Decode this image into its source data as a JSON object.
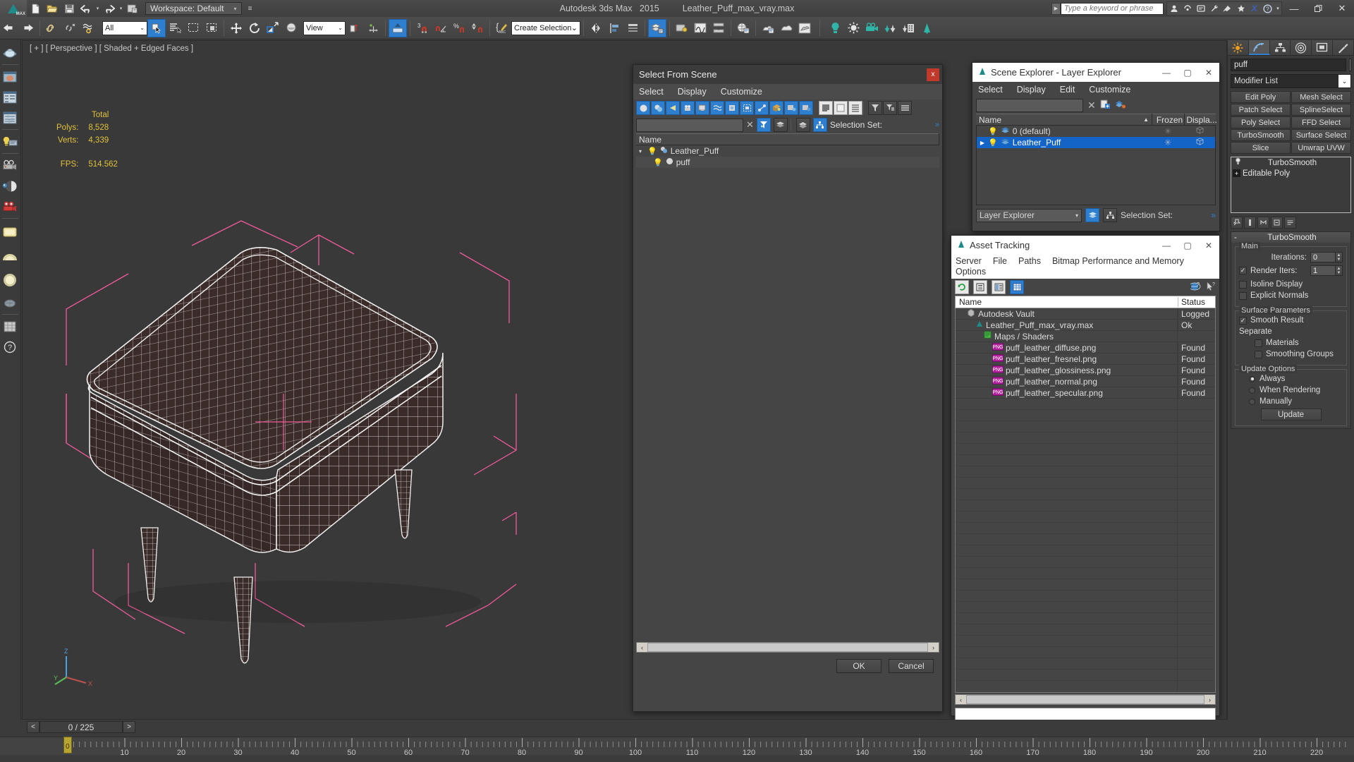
{
  "app": {
    "title_product": "Autodesk 3ds Max",
    "title_version": "2015",
    "title_file": "Leather_Puff_max_vray.max",
    "workspace_label": "Workspace: Default",
    "search_placeholder": "Type a keyword or phrase",
    "accent_blue": "#2f7fd0",
    "bg_dark": "#3b3b3b",
    "stat_yellow": "#e0c13a"
  },
  "titlebar": {
    "quick_icons": [
      "new-file-icon",
      "open-file-icon",
      "save-file-icon",
      "undo-icon",
      "undo-dropdown-icon",
      "redo-icon",
      "redo-dropdown-icon",
      "project-folder-icon"
    ],
    "workspace_arrow": "▾",
    "right_icons": [
      "sign-in-icon",
      "autodesk-360-icon",
      "exchange-app-icon",
      "wrench-icon",
      "communication-center-icon",
      "favorites-star-icon",
      "xref-icon",
      "help-icon"
    ],
    "window_buttons": [
      "minimize",
      "restore",
      "close"
    ]
  },
  "main_toolbar": {
    "groups": [
      {
        "name": "undo-redo",
        "items": [
          "undo-arrow-icon",
          "redo-arrow-icon"
        ]
      },
      {
        "name": "link",
        "items": [
          "select-and-link-icon",
          "unlink-selection-icon",
          "bind-to-space-warp-icon"
        ]
      },
      {
        "name": "filter",
        "selected_filter": "All"
      },
      {
        "name": "selection",
        "items": [
          "select-object-icon",
          "select-by-name-icon",
          "rectangular-region-icon",
          "window-crossing-icon"
        ]
      },
      {
        "name": "transform",
        "items": [
          "select-and-move-icon",
          "select-and-rotate-icon",
          "select-and-scale-icon",
          "placement-icon"
        ]
      },
      {
        "name": "coordinate",
        "selected_ref": "View"
      },
      {
        "name": "pivot",
        "items": [
          "use-pivot-point-center-icon"
        ]
      },
      {
        "name": "snap",
        "items": [
          "snaps-toggle-3-icon",
          "angle-snap-icon",
          "percent-snap-icon",
          "spinner-snap-icon"
        ]
      },
      {
        "name": "named-selection",
        "value": "Create Selection Se"
      },
      {
        "name": "mirror-align",
        "items": [
          "mirror-icon",
          "align-icon",
          "layer-manager-icon"
        ]
      },
      {
        "name": "explorers",
        "items": [
          "scene-explorer-icon",
          "manage-layers-icon",
          "curve-editor-icon",
          "schematic-view-icon"
        ]
      },
      {
        "name": "render-tools",
        "items": [
          "material-editor-icon",
          "render-setup-icon",
          "rendered-frame-window-icon",
          "render-production-icon"
        ]
      },
      {
        "name": "create-objects",
        "items": [
          "omni-light-icon",
          "sun-light-icon",
          "camera-icon",
          "foliage-icon",
          "building-icon",
          "tree-icon"
        ]
      }
    ]
  },
  "left_toolbar": {
    "items": [
      "teapot-preview-icon",
      "render-preview-icon",
      "properties-panel-icon",
      "settings-panel-icon",
      "light-setup-icon",
      "camera-setup-icon",
      "material-sphere-icon",
      "render-camera-icon",
      "plane-light-icon",
      "dome-light-icon",
      "sphere-light-icon",
      "teapot-mesh-icon",
      "grid-icon",
      "help-circle-icon"
    ]
  },
  "viewport": {
    "label": "[ + ] [ Perspective ] [ Shaded + Edged Faces ]",
    "stats_header": "Total",
    "stats": [
      {
        "label": "Polys:",
        "value": "8,528"
      },
      {
        "label": "Verts:",
        "value": "4,339"
      }
    ],
    "fps_label": "FPS:",
    "fps_value": "514.562",
    "object_name": "Leather Puff wireframe model",
    "gizmo_color": "#ff4fa0"
  },
  "select_from_scene": {
    "title": "Select From Scene",
    "close_label": "x",
    "menus": [
      "Select",
      "Display",
      "Customize"
    ],
    "toolbar_icons": [
      "display-geometry-icon",
      "display-shapes-icon",
      "display-lights-icon",
      "display-cameras-icon",
      "display-helpers-icon",
      "display-space-warps-icon",
      "display-groups-icon",
      "display-xrefs-icon",
      "display-bones-icon",
      "display-containers-icon",
      "display-particles-icon",
      "display-freeze-icon",
      "expand-all-icon",
      "collapse-all-icon",
      "list-view-icon",
      "filter-icon",
      "filter-selected-icon",
      "sort-icon"
    ],
    "search_value": "",
    "clear_label": "✕",
    "filter_active_icon": "selection-filter-icon",
    "layer_icon": "layers-icon",
    "layers_toggle_icon": "layers-stack-icon",
    "hierarchy_icon": "hierarchy-icon",
    "selection_set_label": "Selection Set:",
    "column_name": "Name",
    "rows": [
      {
        "indent": 0,
        "expander": "▾",
        "icon": "bulb-icon",
        "type_icon": "object-icon",
        "name": "Leather_Puff"
      },
      {
        "indent": 1,
        "expander": "",
        "icon": "bulb-icon",
        "type_icon": "sphere-icon",
        "name": "puff"
      }
    ],
    "ok_label": "OK",
    "cancel_label": "Cancel"
  },
  "scene_explorer": {
    "title": "Scene Explorer - Layer Explorer",
    "app_icon": "max-logo-icon",
    "menus": [
      "Select",
      "Display",
      "Edit",
      "Customize"
    ],
    "search_value": "",
    "clear_icon": "clear-x-icon",
    "new_layer_icon": "new-layer-icon",
    "layer_tools_icon": "layer-tools-icon",
    "columns": [
      "Name",
      "Frozen",
      "Displa..."
    ],
    "sort_arrow": "▲",
    "rows": [
      {
        "name": "0 (default)",
        "selected": false,
        "expander": "",
        "frozen_icon": "snowflake-icon",
        "display_icon": "display-box-icon"
      },
      {
        "name": "Leather_Puff",
        "selected": true,
        "expander": "▶",
        "frozen_icon": "snowflake-icon",
        "display_icon": "display-box-icon"
      }
    ],
    "footer_select_value": "Layer Explorer",
    "footer_dropdown": "▾",
    "footer_icons": [
      "layers-icon",
      "hierarchy-icon"
    ],
    "footer_selection_set": "Selection Set:",
    "window_buttons": [
      "minimize",
      "maximize",
      "close"
    ]
  },
  "asset_tracking": {
    "title": "Asset Tracking",
    "app_icon": "max-logo-icon",
    "menus": [
      "Server",
      "File",
      "Paths",
      "Bitmap Performance and Memory",
      "Options"
    ],
    "toolbar_icons": [
      "refresh-icon",
      "list-view-icon",
      "detail-view-icon",
      "grid-view-icon"
    ],
    "toolbar_right_icons": [
      "globe-help-icon",
      "help-arrow-icon"
    ],
    "columns": [
      "Name",
      "Status"
    ],
    "rows": [
      {
        "indent": 0,
        "icon": "vault-icon",
        "name": "Autodesk Vault",
        "status": "Logged"
      },
      {
        "indent": 1,
        "icon": "max-file-icon",
        "name": "Leather_Puff_max_vray.max",
        "status": "Ok"
      },
      {
        "indent": 2,
        "icon": "maps-shaders-icon",
        "name": "Maps / Shaders",
        "status": ""
      },
      {
        "indent": 3,
        "icon": "png-icon",
        "name": "puff_leather_diffuse.png",
        "status": "Found"
      },
      {
        "indent": 3,
        "icon": "png-icon",
        "name": "puff_leather_fresnel.png",
        "status": "Found"
      },
      {
        "indent": 3,
        "icon": "png-icon",
        "name": "puff_leather_glossiness.png",
        "status": "Found"
      },
      {
        "indent": 3,
        "icon": "png-icon",
        "name": "puff_leather_normal.png",
        "status": "Found"
      },
      {
        "indent": 3,
        "icon": "png-icon",
        "name": "puff_leather_specular.png",
        "status": "Found"
      }
    ],
    "status_bar_value": "",
    "window_buttons": [
      "minimize",
      "maximize",
      "close"
    ]
  },
  "command_panel": {
    "tabs": [
      "create-tab-icon",
      "modify-tab-icon",
      "hierarchy-tab-icon",
      "motion-tab-icon",
      "display-tab-icon",
      "utilities-tab-icon"
    ],
    "selected_tab_index": 1,
    "object_name": "puff",
    "modifier_list_label": "Modifier List",
    "modifier_buttons": [
      "Edit Poly",
      "Mesh Select",
      "Patch Select",
      "SplineSelect",
      "Poly Select",
      "FFD Select",
      "TurboSmooth",
      "Surface Select",
      "Slice",
      "Unwrap UVW"
    ],
    "stack": [
      {
        "name": "TurboSmooth",
        "icon": "lightbulb-stack-icon",
        "expandable": false
      },
      {
        "name": "Editable Poly",
        "icon": "plus-expand-icon",
        "expandable": true
      }
    ],
    "stack_tool_icons": [
      "pin-stack-icon",
      "show-end-result-icon",
      "make-unique-icon",
      "remove-modifier-icon",
      "configure-sets-icon"
    ],
    "turbosmooth": {
      "rollout_title": "TurboSmooth",
      "collapse_glyph": "-",
      "main_group": "Main",
      "iterations_label": "Iterations:",
      "iterations_value": "0",
      "render_iters_label": "Render Iters:",
      "render_iters_value": "1",
      "render_iters_checked": true,
      "isoline_label": "Isoline Display",
      "isoline_checked": false,
      "explicit_normals_label": "Explicit Normals",
      "explicit_normals_checked": false,
      "surface_group": "Surface Parameters",
      "smooth_result_label": "Smooth Result",
      "smooth_result_checked": true,
      "separate_label": "Separate",
      "materials_label": "Materials",
      "materials_checked": false,
      "smoothing_groups_label": "Smoothing Groups",
      "smoothing_groups_checked": false,
      "update_group": "Update Options",
      "update_options": [
        "Always",
        "When Rendering",
        "Manually"
      ],
      "update_selected": 0,
      "update_button": "Update"
    }
  },
  "timeline": {
    "frame_display": "0 / 225",
    "prev_label": "<",
    "next_label": ">",
    "key_filter_icon": "key-filter-icon",
    "current_frame": 0,
    "range_start": 0,
    "range_end": 225,
    "tick_labels": [
      10,
      20,
      30,
      40,
      50,
      60,
      70,
      80,
      90,
      100,
      110,
      120,
      130,
      140,
      150,
      160,
      170,
      180,
      190,
      200,
      210,
      220
    ]
  }
}
